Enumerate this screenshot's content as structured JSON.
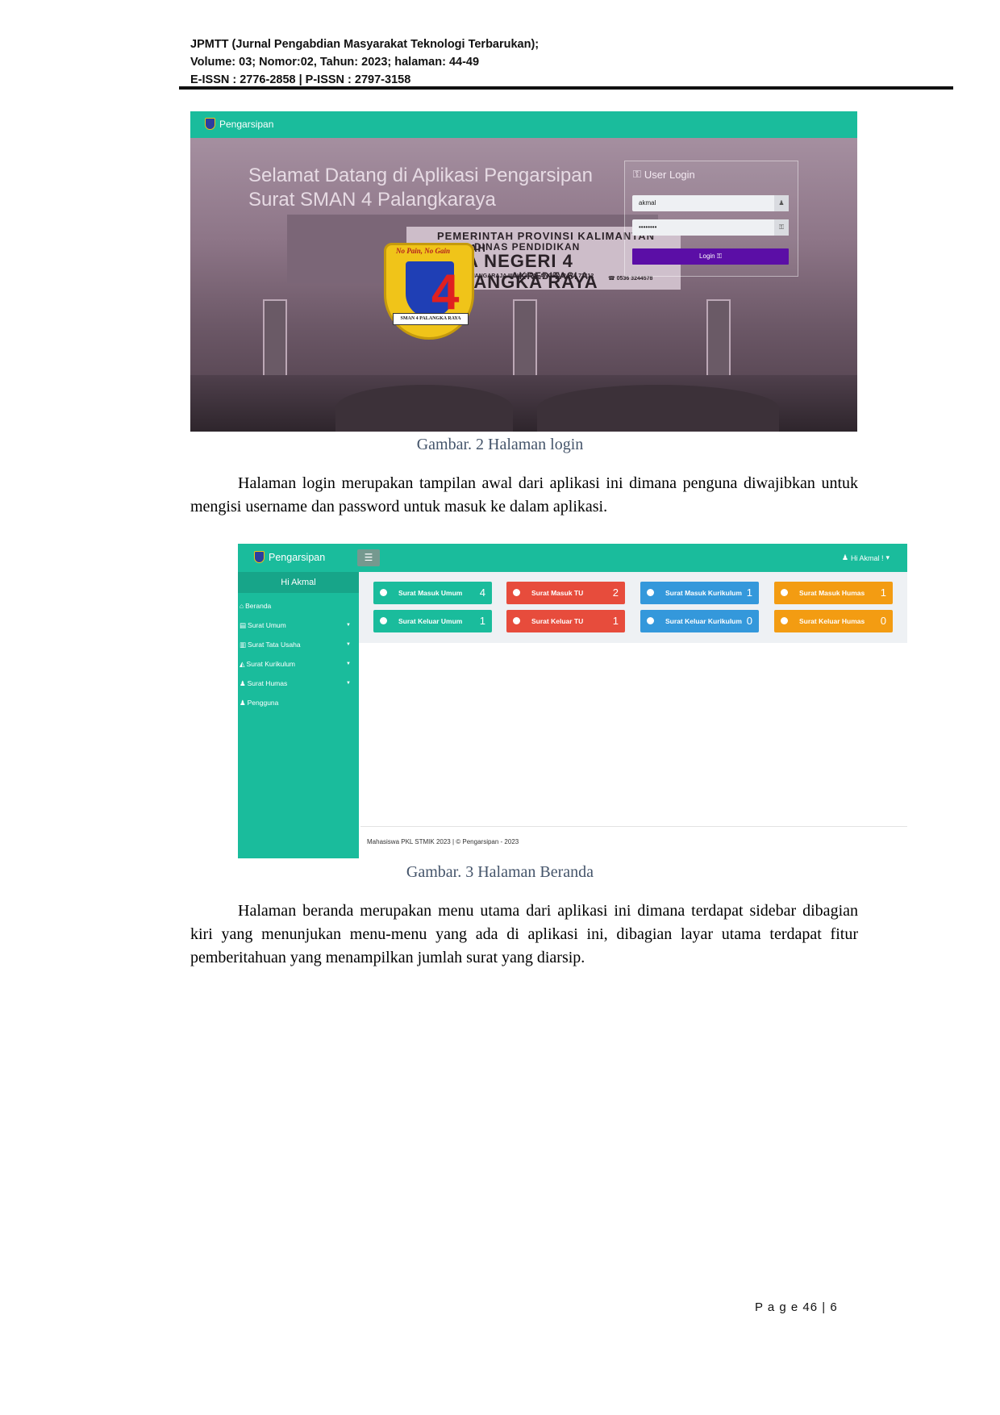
{
  "header": {
    "line1": "JPMTT (Jurnal Pengabdian Masyarakat Teknologi Terbarukan);",
    "line2": "Volume: 03; Nomor:02, Tahun: 2023; halaman: 44-49",
    "line3": "E-ISSN : 2776-2858 | P-ISSN : 2797-3158"
  },
  "figure2": {
    "app_name": "Pengarsipan",
    "welcome_line1": "Selamat Datang di Aplikasi Pengarsipan",
    "welcome_line2": "Surat SMAN 4 Palangkaraya",
    "login_title": "User Login",
    "username_value": "akmal",
    "password_value": "••••••••",
    "login_button": "Login",
    "logo_motto": "No Pain, No Gain",
    "logo_number": "4",
    "logo_band": "SMAN 4 PALANGKA RAYA",
    "sign": {
      "l1": "PEMERINTAH PROVINSI KALIMANTAN TENGAH",
      "l2": "DINAS PENDIDIKAN",
      "l3": "SMA NEGERI 4 PALANGKA RAYA",
      "l4": "JL. SISINGAMANGARAJA III NO.3 PALANGKA RAYA 73112",
      "l5": "AKREDITASI A",
      "l6": "☎ 0536 3244578"
    },
    "caption": "Gambar. 2 Halaman login"
  },
  "para1": {
    "text": "Halaman login merupakan tampilan awal dari aplikasi ini dimana penguna diwajibkan untuk mengisi username dan password untuk masuk ke dalam aplikasi."
  },
  "figure3": {
    "app_name": "Pengarsipan",
    "toggle_icon": "☰",
    "user_menu": "Hi Akmal !",
    "sidebar_greeting": "Hi Akmal",
    "sidebar_items": [
      {
        "label": "Beranda",
        "icon": "home-icon"
      },
      {
        "label": "Surat Umum",
        "icon": "list-icon"
      },
      {
        "label": "Surat Tata Usaha",
        "icon": "book-icon"
      },
      {
        "label": "Surat Kurikulum",
        "icon": "graduation-cap-icon"
      },
      {
        "label": "Surat Humas",
        "icon": "users-icon"
      },
      {
        "label": "Pengguna",
        "icon": "user-icon"
      }
    ],
    "tiles": [
      {
        "label": "Surat Masuk Umum",
        "count": "4",
        "color": "#1abc9c"
      },
      {
        "label": "Surat Masuk TU",
        "count": "2",
        "color": "#e74c3c"
      },
      {
        "label": "Surat Masuk Kurikulum",
        "count": "1",
        "color": "#3498db"
      },
      {
        "label": "Surat Masuk Humas",
        "count": "1",
        "color": "#f39c12"
      },
      {
        "label": "Surat Keluar Umum",
        "count": "1",
        "color": "#1abc9c"
      },
      {
        "label": "Surat Keluar TU",
        "count": "1",
        "color": "#e74c3c"
      },
      {
        "label": "Surat Keluar Kurikulum",
        "count": "0",
        "color": "#3498db"
      },
      {
        "label": "Surat Keluar Humas",
        "count": "0",
        "color": "#f39c12"
      }
    ],
    "footer": "Mahasiswa PKL STMIK 2023 | © Pengarsipan - 2023",
    "caption": "Gambar. 3 Halaman Beranda"
  },
  "para2": {
    "text": "Halaman beranda merupakan menu utama dari aplikasi ini dimana terdapat sidebar dibagian kiri yang menunjukan menu-menu yang ada di aplikasi ini, dibagian layar utama terdapat fitur pemberitahuan yang menampilkan jumlah surat yang diarsip."
  },
  "page_number": "P a g e  46 | 6"
}
